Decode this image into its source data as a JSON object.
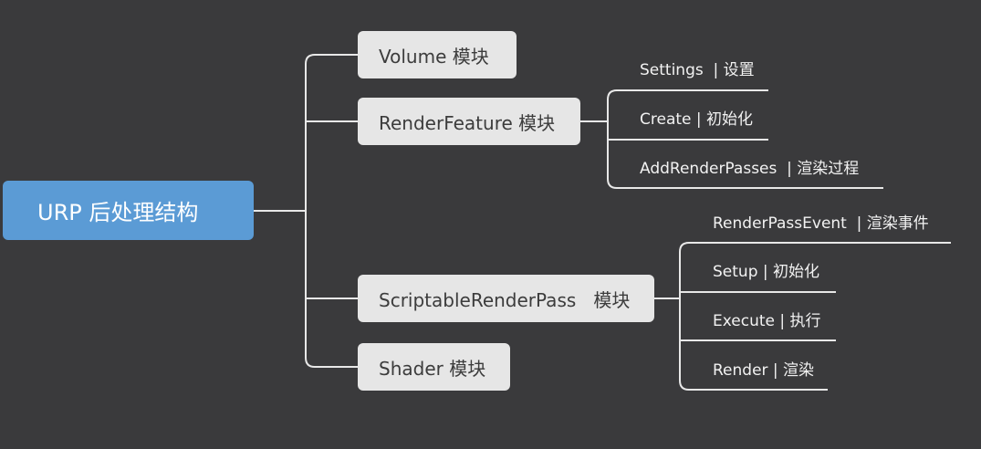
{
  "root": {
    "label": "URP 后处理结构"
  },
  "branches": [
    {
      "label": "Volume 模块",
      "children": []
    },
    {
      "label": "RenderFeature 模块",
      "children": [
        "Settings  | 设置",
        "Create | 初始化",
        "AddRenderPasses  | 渲染过程"
      ]
    },
    {
      "label": "ScriptableRenderPass   模块",
      "children": [
        "RenderPassEvent  | 渲染事件",
        "Setup | 初始化",
        "Execute | 执行",
        "Render | 渲染"
      ]
    },
    {
      "label": "Shader 模块",
      "children": []
    }
  ],
  "colors": {
    "background": "#3a3a3c",
    "root_fill": "#5b9bd5",
    "branch_fill": "#e6e6e6",
    "connector": "#e8e8e8"
  }
}
